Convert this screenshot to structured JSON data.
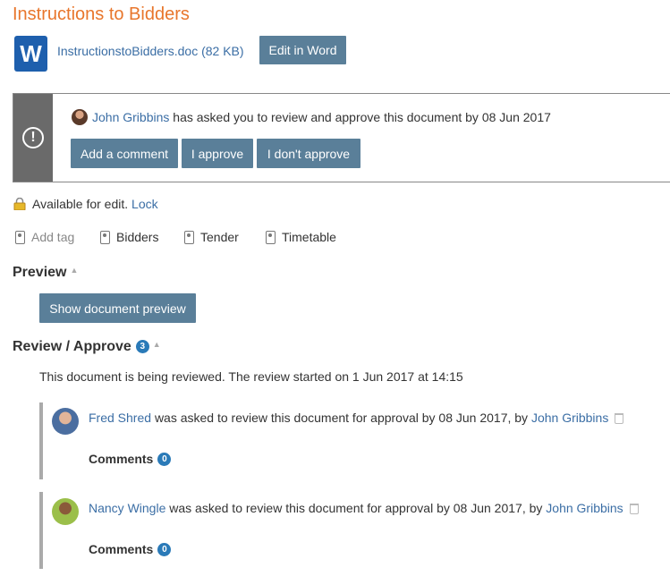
{
  "document": {
    "title": "Instructions to Bidders",
    "file_icon": "word-icon",
    "file_icon_letter": "W",
    "file_name": "InstructionstoBidders.doc (82 KB)",
    "edit_button": "Edit in Word"
  },
  "review_request": {
    "icon": "exclamation-circle-icon",
    "alert_glyph": "!",
    "requester": "John Gribbins",
    "message": "has asked you to review and approve this document by 08 Jun 2017",
    "buttons": {
      "comment": "Add a comment",
      "approve": "I approve",
      "reject": "I don't approve"
    }
  },
  "lock": {
    "status": "Available for edit.",
    "action": "Lock"
  },
  "tags": {
    "add_label": "Add tag",
    "items": [
      "Bidders",
      "Tender",
      "Timetable"
    ]
  },
  "preview": {
    "heading": "Preview",
    "button": "Show document preview"
  },
  "review": {
    "heading": "Review / Approve",
    "count": "3",
    "status": "This document is being reviewed. The review started on 1 Jun 2017 at 14:15",
    "reviewers": [
      {
        "name": "Fred Shred",
        "text": "was asked to review this document for approval by 08 Jun 2017, by",
        "by": "John Gribbins",
        "comments_label": "Comments",
        "comments_count": "0"
      },
      {
        "name": "Nancy Wingle",
        "text": "was asked to review this document for approval by 08 Jun 2017, by",
        "by": "John Gribbins",
        "comments_label": "Comments",
        "comments_count": "0"
      }
    ]
  },
  "colors": {
    "title": "#e8762c",
    "button": "#5a7f99",
    "link": "#3b6ea5",
    "badge": "#2a7ab8",
    "word": "#1e5fad"
  }
}
